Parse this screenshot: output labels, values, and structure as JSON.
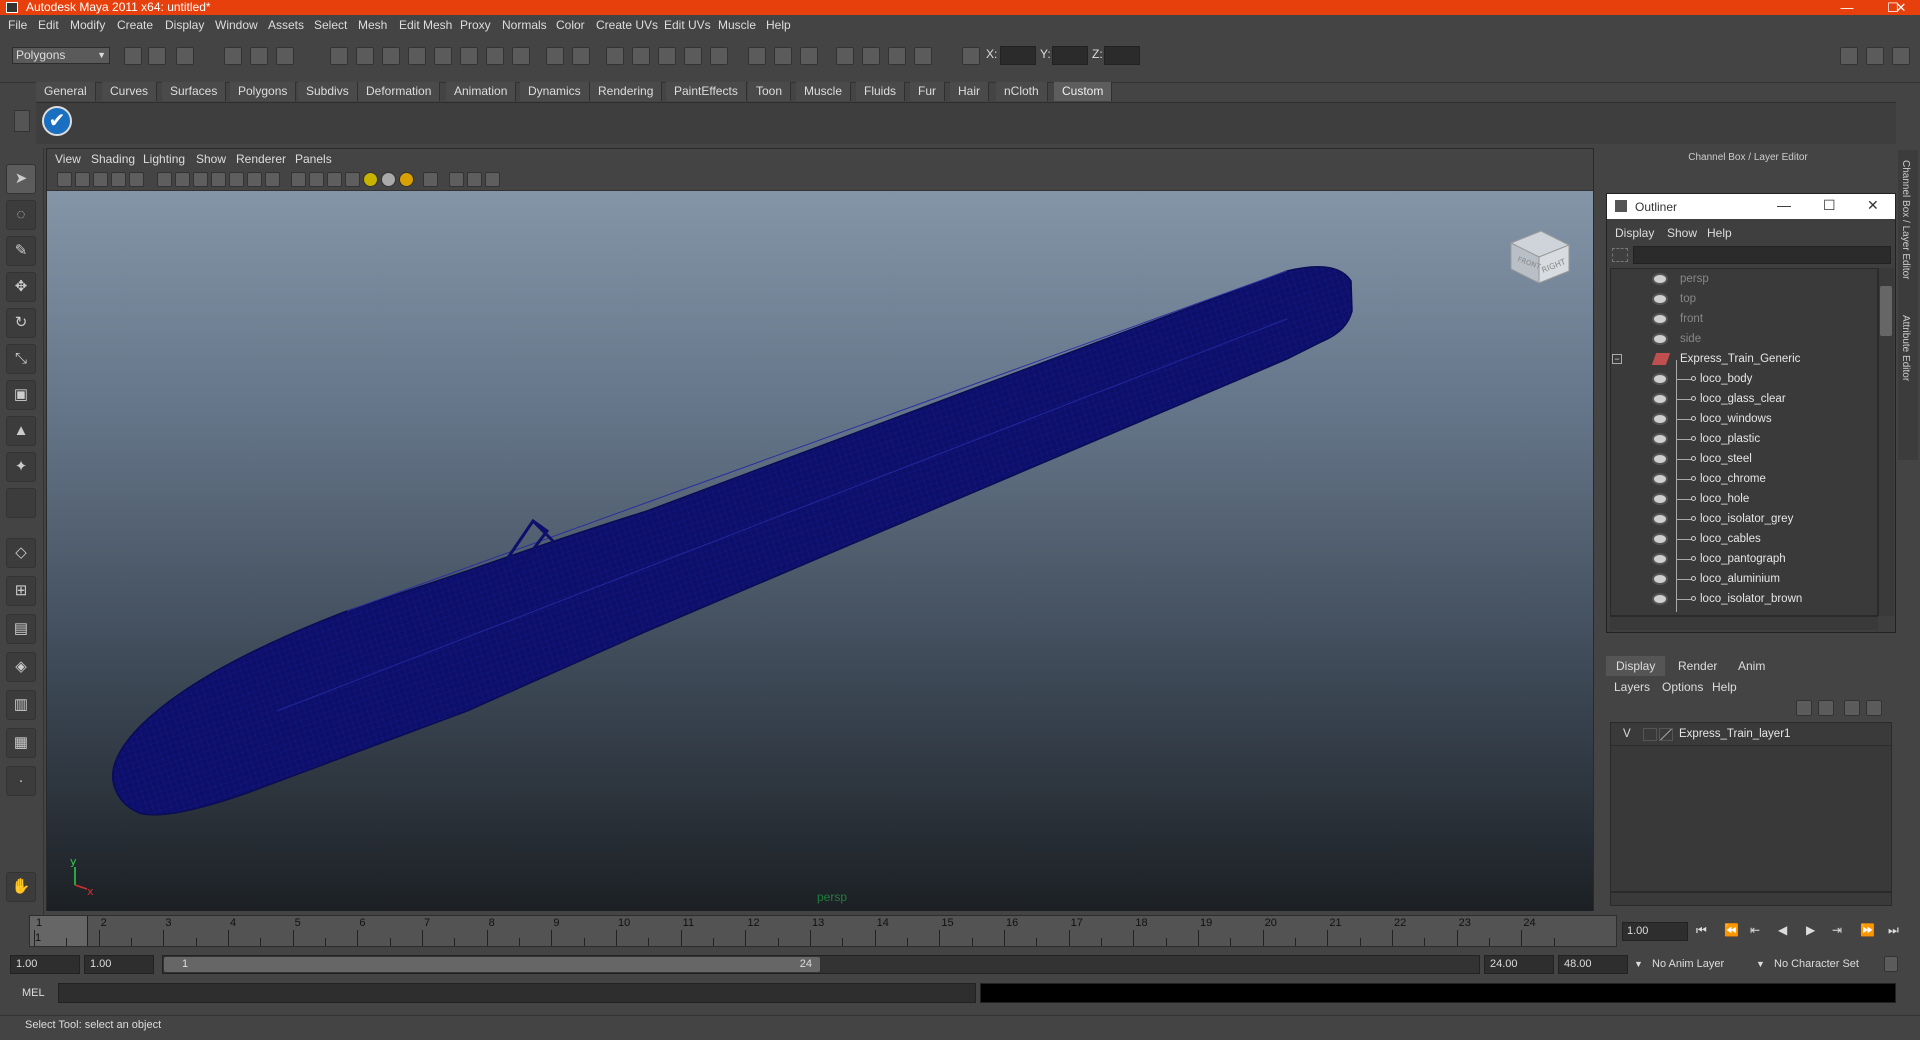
{
  "window": {
    "title": "Autodesk Maya 2011 x64: untitled*",
    "controls": {
      "minimize": "—",
      "maximize": "☐",
      "close": "✕"
    }
  },
  "menubar": [
    "File",
    "Edit",
    "Modify",
    "Create",
    "Display",
    "Window",
    "Assets",
    "Select",
    "Mesh",
    "Edit Mesh",
    "Proxy",
    "Normals",
    "Color",
    "Create UVs",
    "Edit UVs",
    "Muscle",
    "Help"
  ],
  "statusline": {
    "mode": "Polygons",
    "x_label": "X:",
    "y_label": "Y:",
    "z_label": "Z:"
  },
  "shelf": {
    "tabs": [
      "General",
      "Curves",
      "Surfaces",
      "Polygons",
      "Subdivs",
      "Deformation",
      "Animation",
      "Dynamics",
      "Rendering",
      "PaintEffects",
      "Toon",
      "Muscle",
      "Fluids",
      "Fur",
      "Hair",
      "nCloth",
      "Custom"
    ],
    "active_tab": "Custom",
    "icon": "checkmark-icon"
  },
  "viewport": {
    "menu": [
      "View",
      "Shading",
      "Lighting",
      "Show",
      "Renderer",
      "Panels"
    ],
    "camera_label": "persp",
    "viewcube": {
      "front": "FRONT",
      "right": "RIGHT"
    },
    "axis": {
      "y": "y",
      "x": "x"
    },
    "colors": {
      "wireframe": "#0d0f6b",
      "bg_top": "#8595a8",
      "bg_bottom": "#1c2024"
    }
  },
  "channel_box": {
    "header": "Channel Box / Layer Editor",
    "side_tabs": [
      "Channel Box / Layer Editor",
      "Attribute Editor"
    ]
  },
  "outliner": {
    "title": "Outliner",
    "menu": [
      "Display",
      "Show",
      "Help"
    ],
    "collapse_symbol": "−",
    "cameras": [
      "persp",
      "top",
      "front",
      "side"
    ],
    "group": "Express_Train_Generic",
    "children": [
      "loco_body",
      "loco_glass_clear",
      "loco_windows",
      "loco_plastic",
      "loco_steel",
      "loco_chrome",
      "loco_hole",
      "loco_isolator_grey",
      "loco_cables",
      "loco_pantograph",
      "loco_aluminium",
      "loco_isolator_brown"
    ]
  },
  "layer_editor": {
    "tabs": [
      "Display",
      "Render",
      "Anim"
    ],
    "active_tab": "Display",
    "menu": [
      "Layers",
      "Options",
      "Help"
    ],
    "layers": [
      {
        "visible": "V",
        "name": "Express_Train_layer1"
      }
    ]
  },
  "timeline": {
    "ticks": [
      "1",
      "2",
      "3",
      "4",
      "5",
      "6",
      "7",
      "8",
      "9",
      "10",
      "11",
      "12",
      "13",
      "14",
      "15",
      "16",
      "17",
      "18",
      "19",
      "20",
      "21",
      "22",
      "23",
      "24"
    ],
    "current_frame_marker": "1",
    "current_frame": "1.00",
    "playback": {
      "go_start": "⏮",
      "step_back": "⏭",
      "key_back": "⇤",
      "play_back": "◀",
      "play_fwd": "▶",
      "key_fwd": "⇥",
      "step_fwd": "⏭",
      "go_end": "⏭"
    }
  },
  "range": {
    "start": "1.00",
    "playback_start": "1.00",
    "range_start_label": "1",
    "range_end_label": "24",
    "playback_end": "24.00",
    "end": "48.00",
    "anim_layer": "No Anim Layer",
    "character_set": "No Character Set"
  },
  "command": {
    "label": "MEL"
  },
  "helpline": {
    "text": "Select Tool: select an object"
  }
}
